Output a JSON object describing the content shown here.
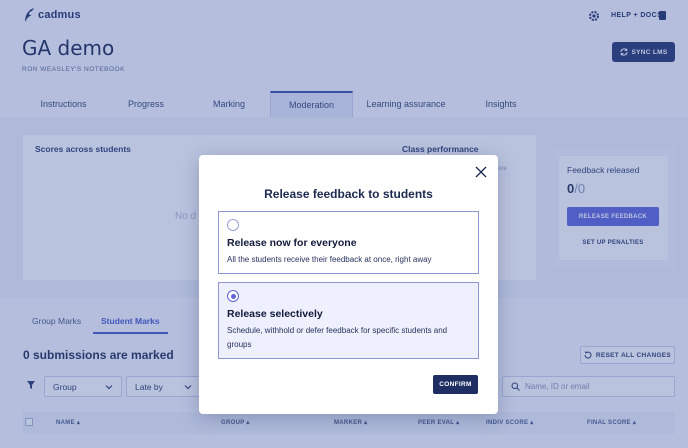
{
  "brand": {
    "name": "cadmus"
  },
  "header": {
    "help_label": "HELP + DOCS",
    "title": "GA demo",
    "subtitle": "RON WEASLEY'S NOTEBOOK",
    "sync_label": "SYNC LMS"
  },
  "tabs": [
    {
      "label": "Instructions",
      "active": false
    },
    {
      "label": "Progress",
      "active": false
    },
    {
      "label": "Marking",
      "active": false
    },
    {
      "label": "Moderation",
      "active": true
    },
    {
      "label": "Learning assurance",
      "active": false
    },
    {
      "label": "Insights",
      "active": false
    }
  ],
  "scores": {
    "title": "Scores across students",
    "class_performance": "Class performance",
    "no_data_fragment": "No d",
    "score_fragment": "ore"
  },
  "feedback": {
    "title": "Feedback released",
    "released": "0",
    "total": "/0",
    "release_button": "RELEASE FEEDBACK",
    "penalties_link": "SET UP PENALTIES"
  },
  "marks": {
    "subtabs": [
      {
        "label": "Group Marks",
        "active": false
      },
      {
        "label": "Student Marks",
        "active": true
      }
    ],
    "summary": "0 submissions are marked",
    "reset_label": "RESET ALL CHANGES",
    "filters": {
      "group": "Group",
      "late": "Late by"
    },
    "search_placeholder": "Name, ID or email",
    "columns": [
      "NAME",
      "GROUP",
      "MARKER",
      "PEER EVAL",
      "INDIV SCORE",
      "FINAL SCORE"
    ]
  },
  "modal": {
    "title": "Release feedback to students",
    "options": [
      {
        "label": "Release now for everyone",
        "description": "All the students receive their feedback at once, right away",
        "selected": false
      },
      {
        "label": "Release selectively",
        "description": "Schedule, withhold or defer feedback for specific students and groups",
        "selected": true
      }
    ],
    "confirm_label": "CONFIRM"
  },
  "colors": {
    "primary_dark": "#1e2e63",
    "accent": "#5d65d9",
    "overlay": "#3a54a0"
  }
}
